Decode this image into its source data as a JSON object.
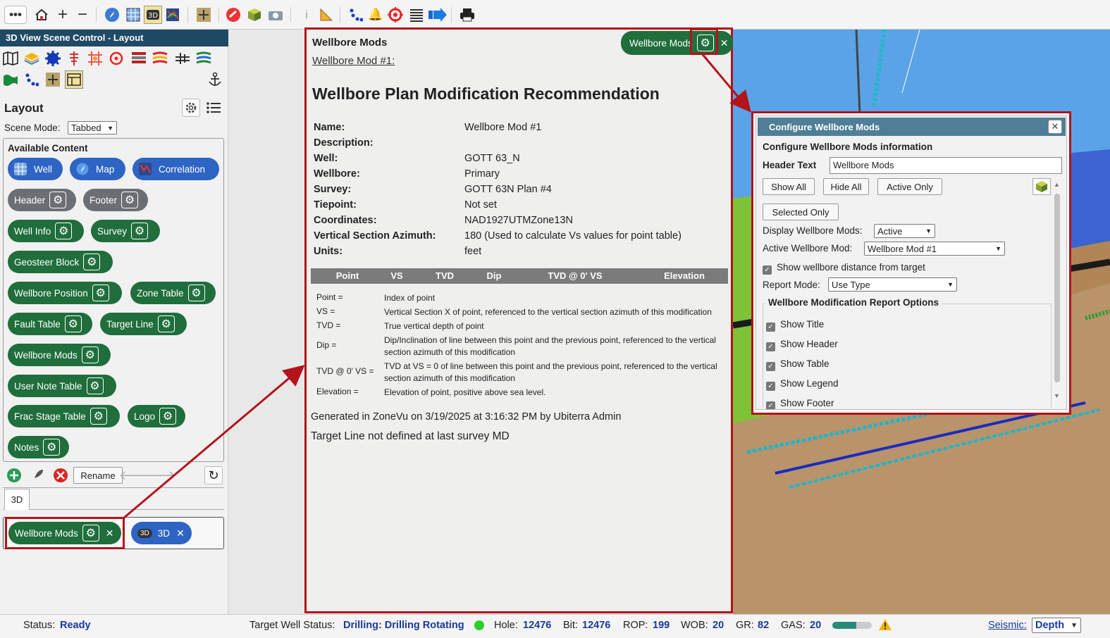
{
  "toolbar": {
    "more_icon": "more-icon",
    "home_icon": "home-icon",
    "zoom_in": "+",
    "zoom_out": "−"
  },
  "left_panel": {
    "title": "3D View Scene Control - Layout",
    "layout_heading": "Layout",
    "scene_mode_label": "Scene Mode:",
    "scene_mode_value": "Tabbed",
    "available_content_label": "Available Content",
    "content_pills": {
      "well": "Well",
      "map": "Map",
      "correlation": "Correlation",
      "header": "Header",
      "footer": "Footer",
      "well_info": "Well Info",
      "survey": "Survey",
      "geosteer_block": "Geosteer Block",
      "wellbore_position": "Wellbore Position",
      "zone_table": "Zone Table",
      "fault_table": "Fault Table",
      "target_line": "Target Line",
      "wellbore_mods": "Wellbore Mods",
      "user_note_table": "User Note Table",
      "frac_stage_table": "Frac Stage Table",
      "logo": "Logo",
      "notes": "Notes"
    },
    "rename_label": "Rename",
    "tab_label": "3D",
    "tab_items": {
      "wellbore_mods": "Wellbore Mods",
      "threed": "3D",
      "threed_icon_text": "3D"
    }
  },
  "report": {
    "header_text": "Wellbore Mods",
    "mod_link": "Wellbore Mod #1:",
    "tab_chip_label": "Wellbore Mods",
    "title": "Wellbore Plan Modification Recommendation",
    "fields": [
      {
        "label": "Name:",
        "value": "Wellbore Mod #1"
      },
      {
        "label": "Description:",
        "value": ""
      },
      {
        "label": "Well:",
        "value": "GOTT 63_N"
      },
      {
        "label": "Wellbore:",
        "value": "Primary"
      },
      {
        "label": "Survey:",
        "value": "GOTT 63N Plan #4"
      },
      {
        "label": "Tiepoint:",
        "value": "Not set"
      },
      {
        "label": "Coordinates:",
        "value": "NAD1927UTMZone13N"
      },
      {
        "label": "Vertical Section Azimuth:",
        "value": "180 (Used to calculate Vs values for point table)"
      },
      {
        "label": "Units:",
        "value": "feet"
      }
    ],
    "table_headers": [
      "Point",
      "VS",
      "TVD",
      "Dip",
      "TVD @ 0' VS",
      "Elevation"
    ],
    "legend": [
      {
        "key": "Point =",
        "desc": "Index of point"
      },
      {
        "key": "VS =",
        "desc": "Vertical Section X of point, referenced to the vertical section azimuth of this modification"
      },
      {
        "key": "TVD =",
        "desc": "True vertical depth of point"
      },
      {
        "key": "Dip =",
        "desc": "Dip/Inclination of line between this point and the previous point, referenced to the vertical section azimuth of this modification"
      },
      {
        "key": "TVD @ 0' VS =",
        "desc": "TVD at VS = 0 of line between this point and the previous point, referenced to the vertical section azimuth of this modification"
      },
      {
        "key": "Elevation =",
        "desc": "Elevation of point, positive above sea level."
      }
    ],
    "generated": "Generated in ZoneVu on 3/19/2025 at 3:16:32 PM by Ubiterra Admin",
    "target_line_note": "Target Line not defined at last survey MD"
  },
  "config": {
    "title": "Configure Wellbore Mods",
    "subtitle": "Configure Wellbore Mods information",
    "header_text_label": "Header Text",
    "header_text_value": "Wellbore Mods",
    "show_all": "Show All",
    "hide_all": "Hide All",
    "active_only": "Active Only",
    "selected_only": "Selected Only",
    "display_label": "Display Wellbore Mods:",
    "display_value": "Active",
    "active_label": "Active Wellbore Mod:",
    "active_value": "Wellbore Mod #1",
    "show_distance": "Show wellbore distance from target",
    "report_mode_label": "Report Mode:",
    "report_mode_value": "Use Type",
    "options_legend": "Wellbore Modification Report Options",
    "options": [
      "Show Title",
      "Show Header",
      "Show Table",
      "Show Legend",
      "Show Footer"
    ]
  },
  "status_bar": {
    "status_label": "Status:",
    "status_value": "Ready",
    "target_label": "Target Well Status:",
    "target_value": "Drilling: Drilling Rotating",
    "hole_label": "Hole:",
    "hole_value": "12476",
    "bit_label": "Bit:",
    "bit_value": "12476",
    "rop_label": "ROP:",
    "rop_value": "199",
    "wob_label": "WOB:",
    "wob_value": "20",
    "gr_label": "GR:",
    "gr_value": "82",
    "gas_label": "GAS:",
    "gas_value": "20",
    "gas_level": 0.6,
    "seismic_label": "Seismic:",
    "seismic_value": "Depth"
  },
  "colors": {
    "accent_green": "#1f6e3b",
    "accent_blue": "#2e64c4",
    "highlight_red": "#b3131b",
    "navy": "#1e4a66"
  }
}
